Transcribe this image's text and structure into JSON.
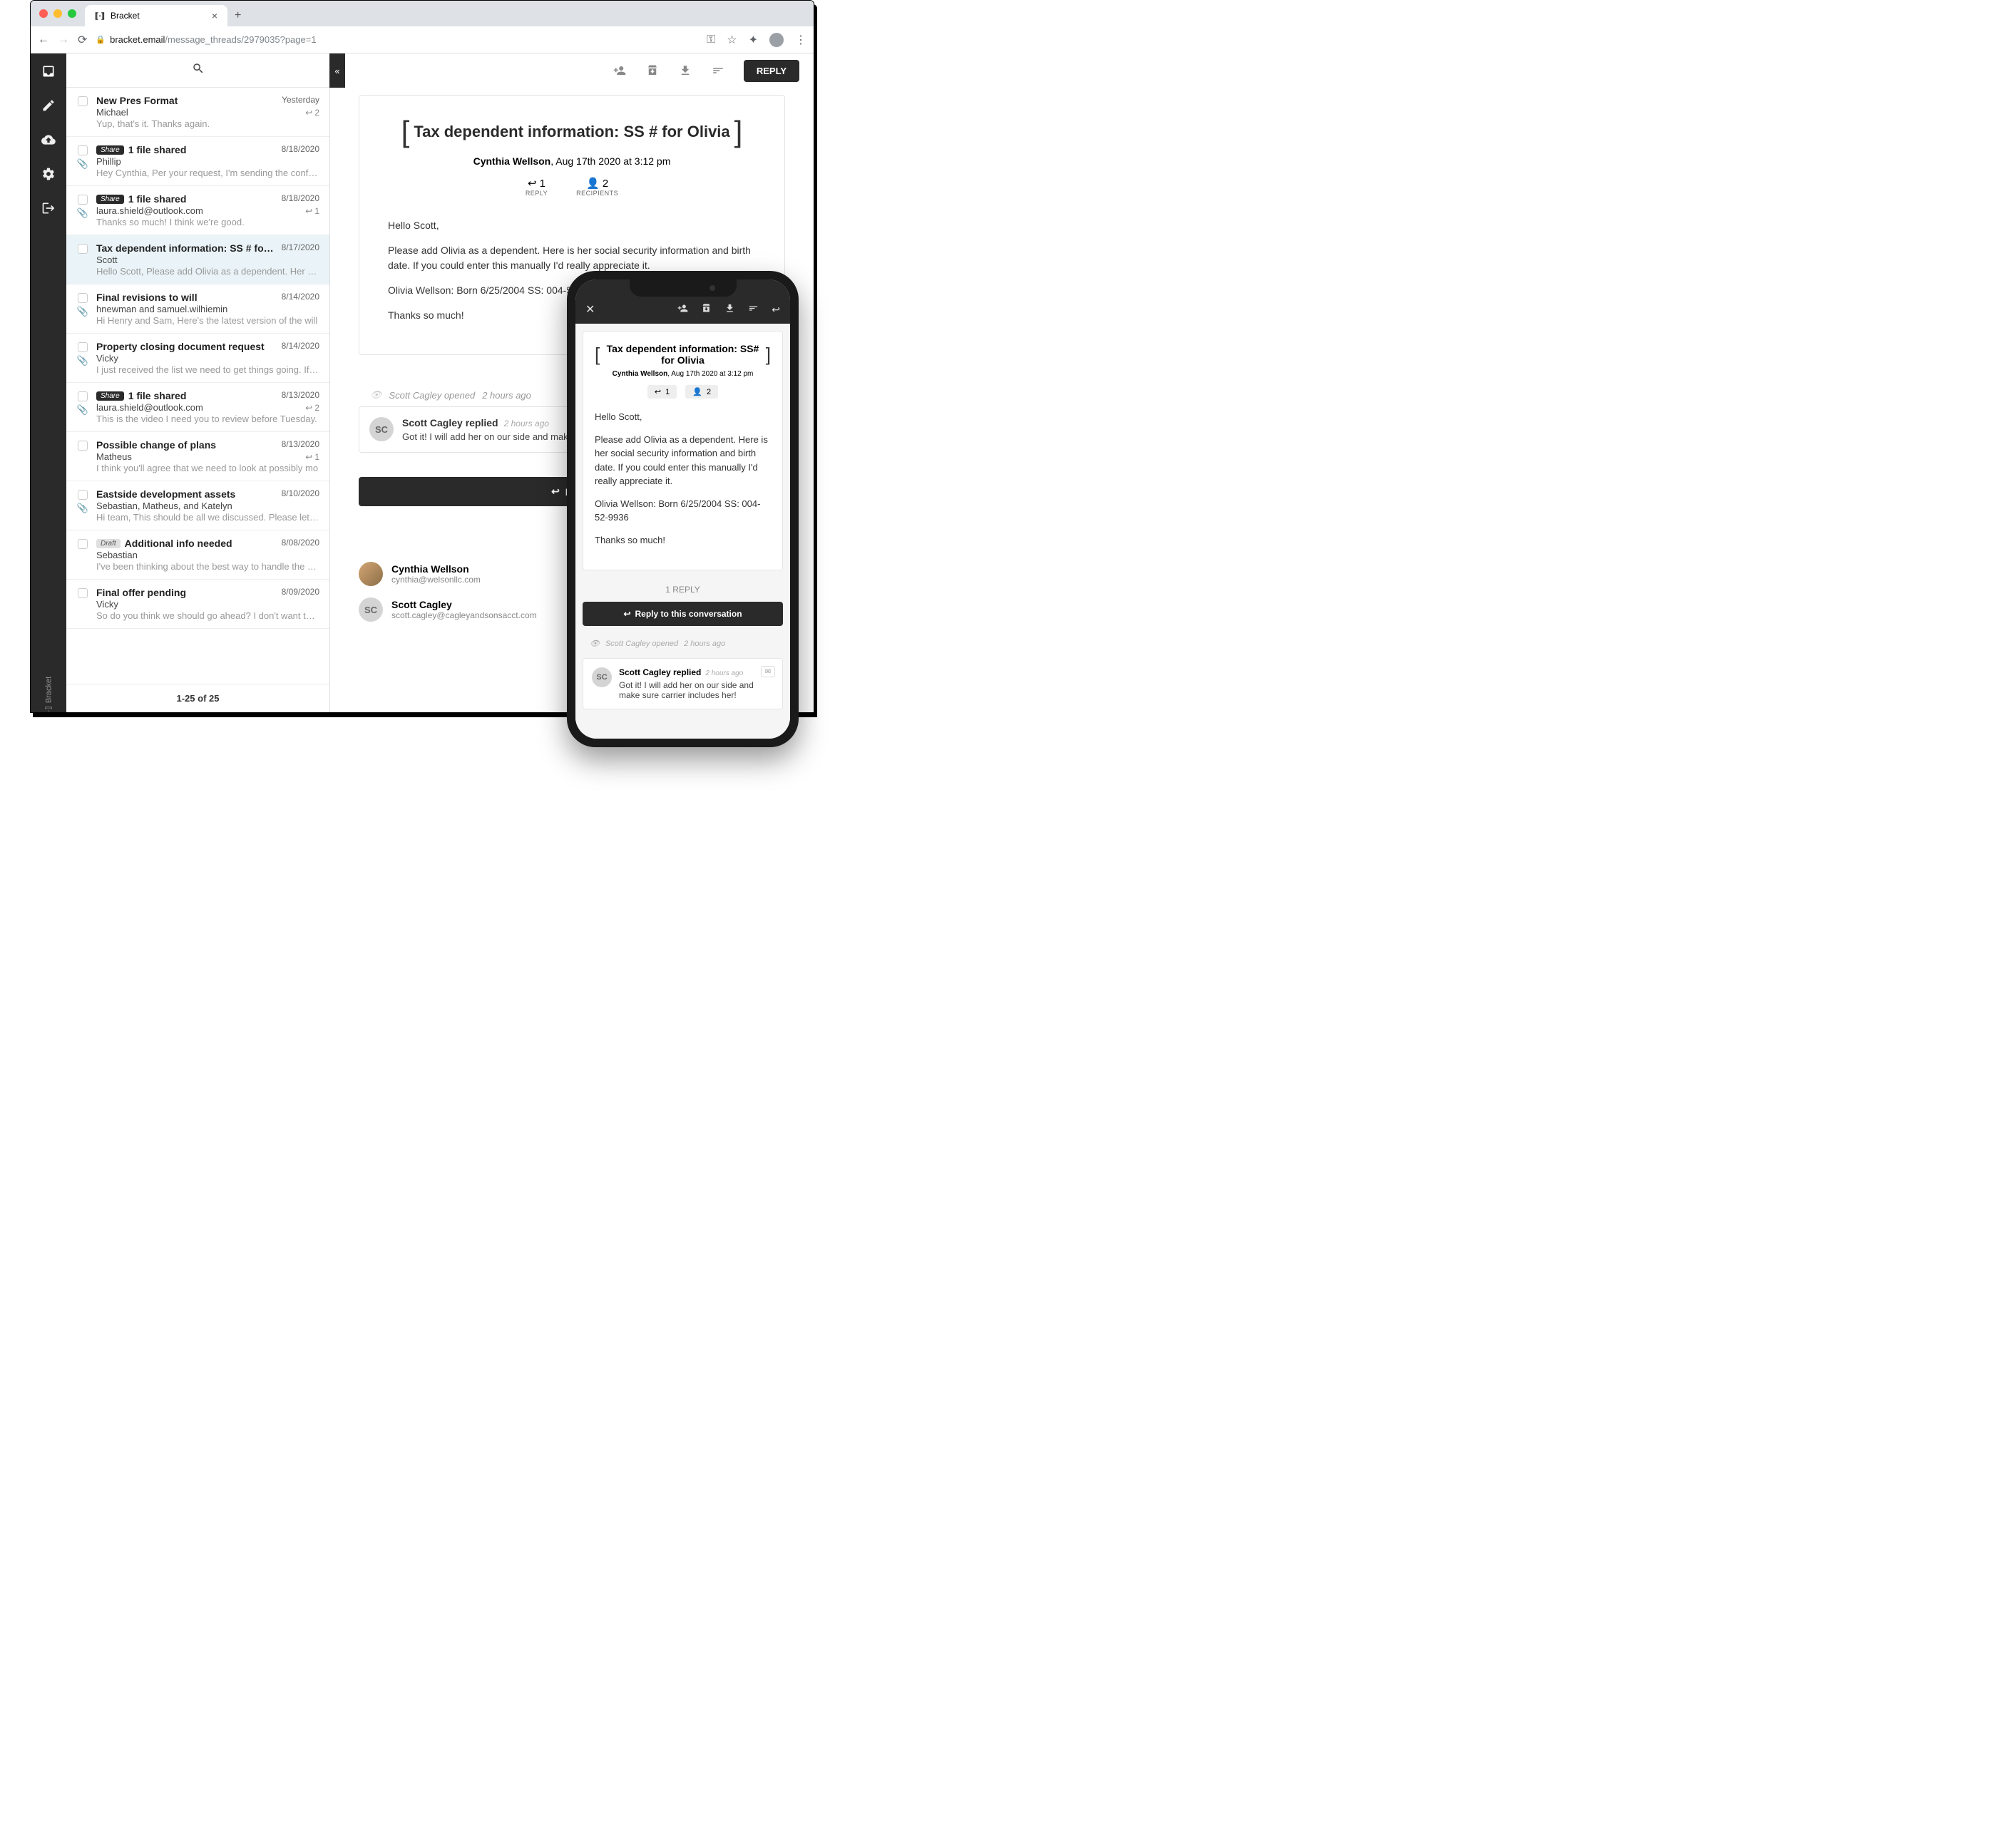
{
  "browser": {
    "tab_title": "Bracket",
    "url_host": "bracket.email",
    "url_path": "/message_threads/2979035?page=1"
  },
  "sidebar_brand": "Bracket",
  "messages": [
    {
      "subject": "New Pres Format",
      "from": "Michael",
      "date": "Yesterday",
      "reply_count": "2",
      "has_clip": false,
      "tag": null,
      "preview": "Yup, that's it. Thanks again."
    },
    {
      "subject": "1 file shared",
      "from": "Phillip",
      "date": "8/18/2020",
      "reply_count": null,
      "has_clip": true,
      "tag": "Share",
      "preview": "Hey Cynthia, Per your request, I'm sending the confide"
    },
    {
      "subject": "1 file shared",
      "from": "laura.shield@outlook.com",
      "date": "8/18/2020",
      "reply_count": "1",
      "has_clip": true,
      "tag": "Share",
      "preview": "Thanks so much! I think we're good."
    },
    {
      "subject": "Tax dependent information: SS # for Olivia",
      "from": "Scott",
      "date": "8/17/2020",
      "reply_count": null,
      "has_clip": false,
      "tag": null,
      "preview": "Hello Scott, Please add Olivia as a dependent. Her soci",
      "selected": true
    },
    {
      "subject": "Final revisions to will",
      "from": "hnewman and samuel.wilhiemin",
      "date": "8/14/2020",
      "reply_count": null,
      "has_clip": true,
      "tag": null,
      "preview": "Hi Henry and Sam, Here's the latest version of the will"
    },
    {
      "subject": "Property closing document request",
      "from": "Vicky",
      "date": "8/14/2020",
      "reply_count": null,
      "has_clip": true,
      "tag": null,
      "preview": "I just received the list we need to get things going. If yo"
    },
    {
      "subject": "1 file shared",
      "from": "laura.shield@outlook.com",
      "date": "8/13/2020",
      "reply_count": "2",
      "has_clip": true,
      "tag": "Share",
      "preview": "This is the video I need you to review before Tuesday."
    },
    {
      "subject": "Possible change of plans",
      "from": "Matheus",
      "date": "8/13/2020",
      "reply_count": "1",
      "has_clip": false,
      "tag": null,
      "preview": "I think you'll agree that we need to look at possibly mo"
    },
    {
      "subject": "Eastside development assets",
      "from": "Sebastian, Matheus, and Katelyn",
      "date": "8/10/2020",
      "reply_count": null,
      "has_clip": true,
      "tag": null,
      "preview": "Hi team, This should be all we discussed. Please let us k"
    },
    {
      "subject": "Additional info needed",
      "from": "Sebastian",
      "date": "8/08/2020",
      "reply_count": null,
      "has_clip": false,
      "tag": "Draft",
      "preview": "I've been thinking about the best way to handle the situ"
    },
    {
      "subject": "Final offer pending",
      "from": "Vicky",
      "date": "8/09/2020",
      "reply_count": null,
      "has_clip": false,
      "tag": null,
      "preview": "So do you think we should go ahead? I don't want to ma"
    }
  ],
  "pager": "1-25  of  25",
  "detail": {
    "title": "Tax dependent information: SS # for Olivia",
    "sender": "Cynthia Wellson",
    "sent_at": ", Aug 17th 2020 at 3:12 pm",
    "stat_reply_n": "1",
    "stat_reply_lbl": "REPLY",
    "stat_recip_n": "2",
    "stat_recip_lbl": "RECIPIENTS",
    "body": {
      "p1": "Hello Scott,",
      "p2": "Please add Olivia as a dependent. Here is her social security information and birth date. If you could enter this manually I'd really appreciate it.",
      "p3": "Olivia Wellson: Born 6/25/2004 SS: 004-52-",
      "p4": "Thanks so much!"
    },
    "opened_by": "Scott Cagley opened",
    "opened_time": "2 hours ago",
    "reply": {
      "initials": "SC",
      "name": "Scott Cagley replied",
      "time": "2 hours ago",
      "text": "Got it! I will add her on our side and mak"
    },
    "reply_btn_label": "Reply",
    "recipients_hdr": "R",
    "recipients": [
      {
        "name": "Cynthia Wellson",
        "email": "cynthia@welsonllc.com",
        "initials": "",
        "photo": true
      },
      {
        "name": "Scott Cagley",
        "email": "scott.cagley@cagleyandsonsacct.com",
        "initials": "SC",
        "photo": false
      }
    ]
  },
  "toolbar": {
    "reply_label": "REPLY"
  },
  "phone": {
    "title": "Tax dependent information: SS# for Olivia",
    "sender": "Cynthia Wellson",
    "sent_at": ", Aug 17th 2020 at 3:12 pm",
    "stat1": "1",
    "stat2": "2",
    "body": {
      "p1": "Hello Scott,",
      "p2": "Please add Olivia as a dependent. Here is her social security information and birth date. If you could enter this manually I'd really appreciate it.",
      "p3": "Olivia Wellson: Born 6/25/2004 SS: 004-52-9936",
      "p4": "Thanks so much!"
    },
    "replies_hdr": "1 REPLY",
    "reply_btn": "Reply to this conversation",
    "opened_by": "Scott Cagley opened",
    "opened_time": "2 hours ago",
    "reply": {
      "initials": "SC",
      "name": "Scott Cagley replied",
      "time": "2 hours ago",
      "text": "Got it! I will add her on our side and make sure carrier includes her!"
    }
  }
}
